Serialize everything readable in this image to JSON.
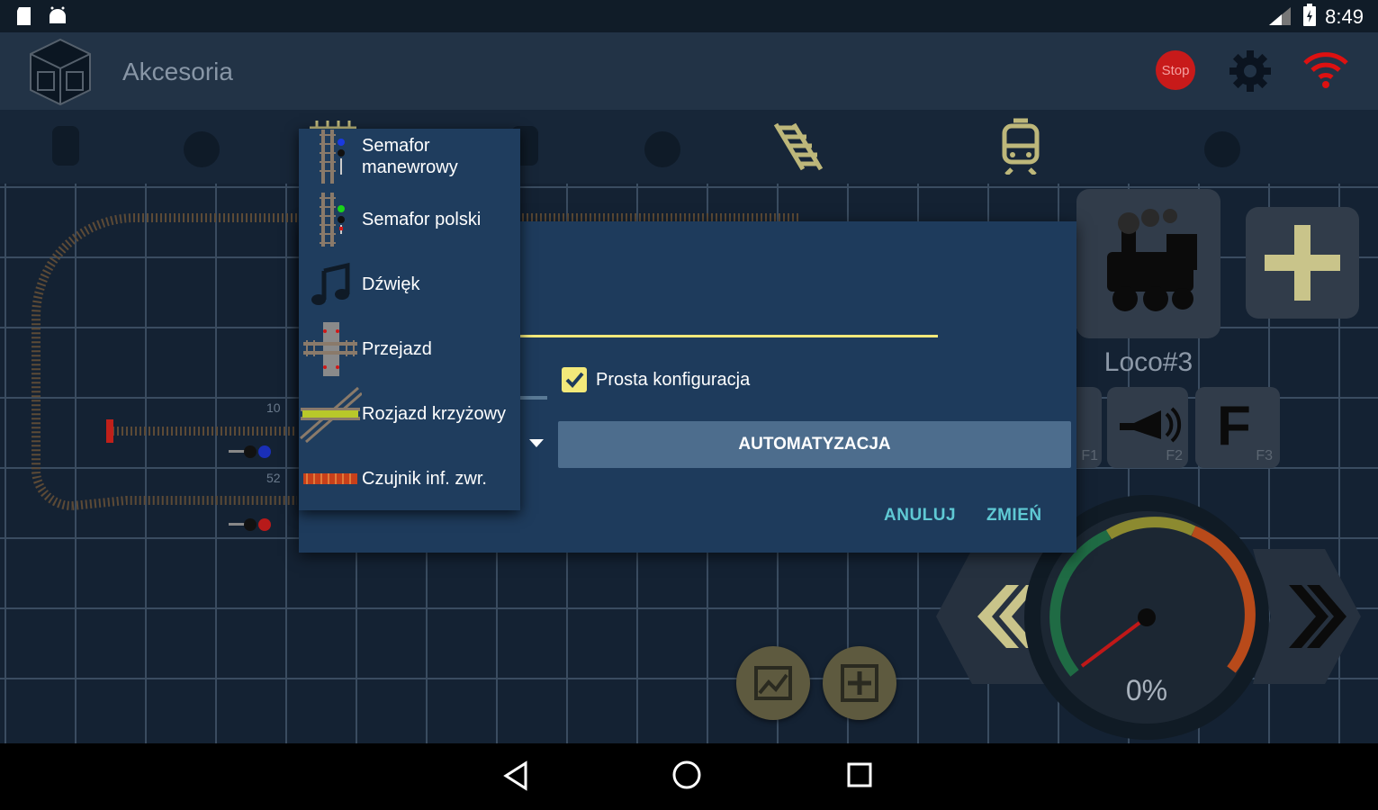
{
  "status_bar": {
    "time": "8:49"
  },
  "toolbar": {
    "title": "Akcesoria",
    "stop_label": "Stop"
  },
  "dialog": {
    "checkbox_label": "Prosta konfiguracja",
    "checkbox_checked": true,
    "automation_button": "AUTOMATYZACJA",
    "cancel_button": "ANULUJ",
    "change_button": "ZMIEŃ"
  },
  "menu": {
    "items": [
      {
        "label_line1": "Semafor",
        "label_line2": "manewrowy",
        "icon": "shunting-signal-icon"
      },
      {
        "label": "Semafor polski",
        "icon": "polish-signal-icon"
      },
      {
        "label": "Dźwięk",
        "icon": "music-note-icon"
      },
      {
        "label": "Przejazd",
        "icon": "level-crossing-icon"
      },
      {
        "label": "Rozjazd krzyżowy",
        "icon": "crossing-switch-icon"
      },
      {
        "label": "Czujnik inf. zwr.",
        "icon": "ir-sensor-icon"
      }
    ]
  },
  "loco": {
    "name": "Loco#3",
    "f1": "F1",
    "f2": "F2",
    "f3": "F3",
    "f3_big": "F"
  },
  "speed": {
    "value": "0%"
  },
  "track_labels": {
    "a": "10",
    "b": "52"
  },
  "colors": {
    "accent": "#5fc9d4",
    "dialog_bg": "#1e3b5c",
    "button_bg": "#4d6d8d",
    "gold": "#c9c48a"
  }
}
